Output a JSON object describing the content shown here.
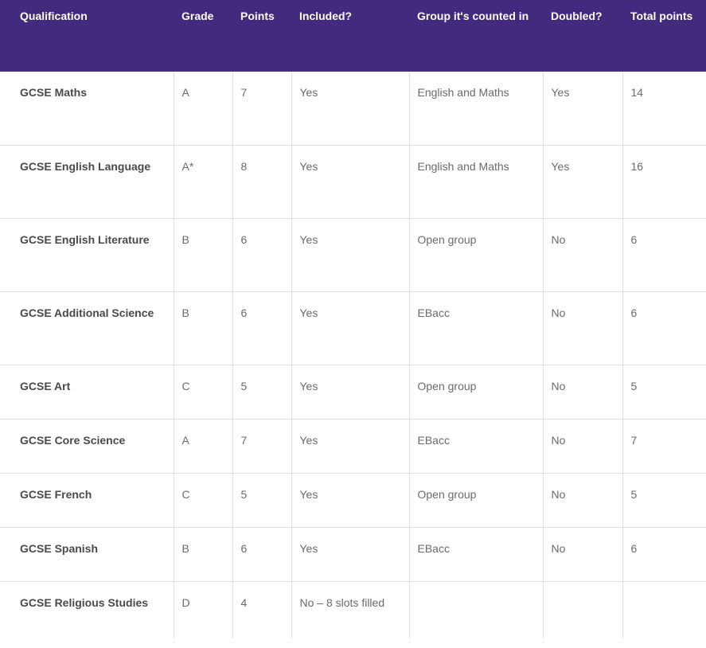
{
  "headers": [
    "Qualification",
    "Grade",
    "Points",
    "Included?",
    "Group it's counted in",
    "Doubled?",
    "Total points"
  ],
  "rows": [
    [
      "GCSE Maths",
      "A",
      "7",
      "Yes",
      "English and Maths",
      "Yes",
      "14"
    ],
    [
      "GCSE English Language",
      "A*",
      "8",
      "Yes",
      "English and Maths",
      "Yes",
      "16"
    ],
    [
      "GCSE English Literature",
      "B",
      "6",
      "Yes",
      "Open group",
      "No",
      "6"
    ],
    [
      "GCSE Additional Science",
      "B",
      "6",
      "Yes",
      "EBacc",
      "No",
      "6"
    ],
    [
      "GCSE Art",
      "C",
      "5",
      "Yes",
      "Open group",
      "No",
      "5"
    ],
    [
      "GCSE Core Science",
      "A",
      "7",
      "Yes",
      "EBacc",
      "No",
      "7"
    ],
    [
      "GCSE French",
      "C",
      "5",
      "Yes",
      "Open group",
      "No",
      "5"
    ],
    [
      "GCSE Spanish",
      "B",
      "6",
      "Yes",
      "EBacc",
      "No",
      "6"
    ],
    [
      "GCSE Religious Studies",
      "D",
      "4",
      "No – 8 slots filled",
      "",
      "",
      ""
    ]
  ],
  "colors": {
    "header_background": "#442a7e",
    "header_text": "#ffffff",
    "cell_text": "#6b6b6b",
    "grid_lines": "#e0e0e0"
  }
}
